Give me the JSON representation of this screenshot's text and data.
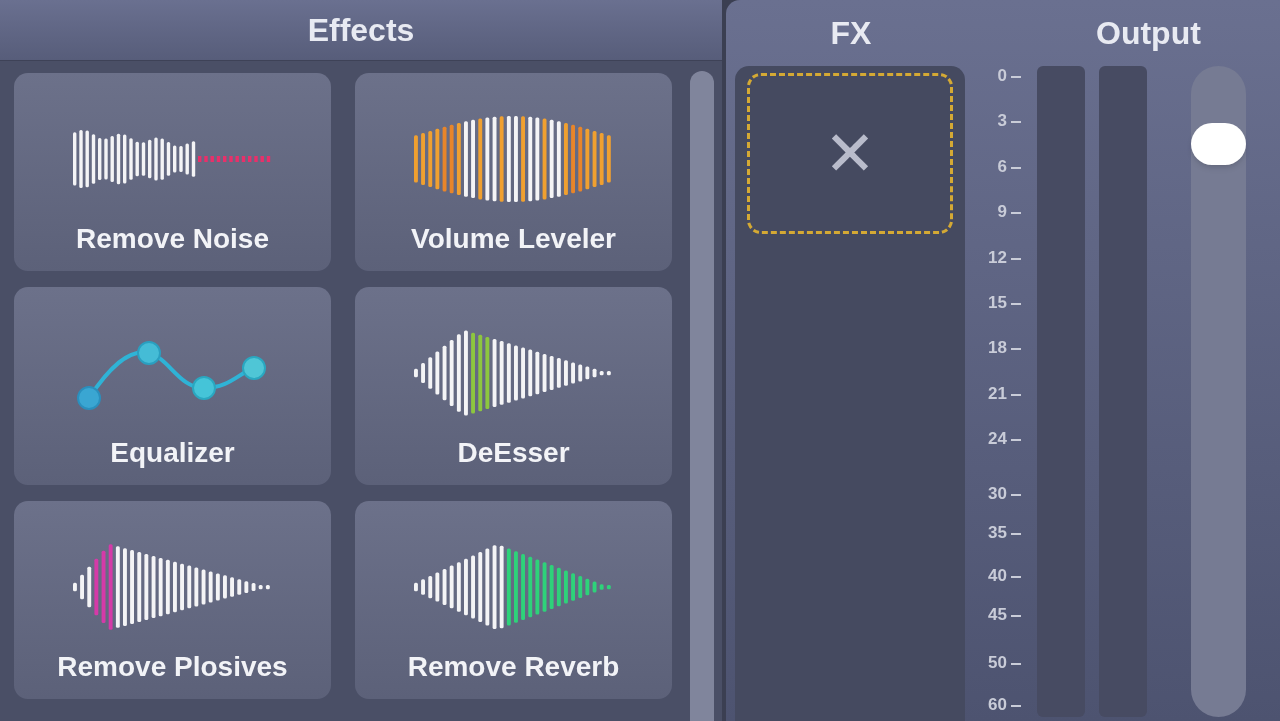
{
  "effects_panel": {
    "title": "Effects",
    "cards": [
      {
        "label": "Remove Noise",
        "kind": "noise"
      },
      {
        "label": "Volume Leveler",
        "kind": "leveler"
      },
      {
        "label": "Equalizer",
        "kind": "eq"
      },
      {
        "label": "DeEsser",
        "kind": "deesser"
      },
      {
        "label": "Remove Plosives",
        "kind": "plosive"
      },
      {
        "label": "Remove Reverb",
        "kind": "reverb"
      }
    ]
  },
  "fx_panel": {
    "title": "FX",
    "slot": {
      "remove_symbol": "✕"
    }
  },
  "output_panel": {
    "title": "Output",
    "scale": [
      "0",
      "3",
      "6",
      "9",
      "12",
      "15",
      "18",
      "21",
      "24",
      "30",
      "35",
      "40",
      "45",
      "50",
      "60"
    ],
    "meters": [
      {
        "level": 0
      },
      {
        "level": 0
      }
    ],
    "volume": {
      "level": 0.88
    }
  }
}
